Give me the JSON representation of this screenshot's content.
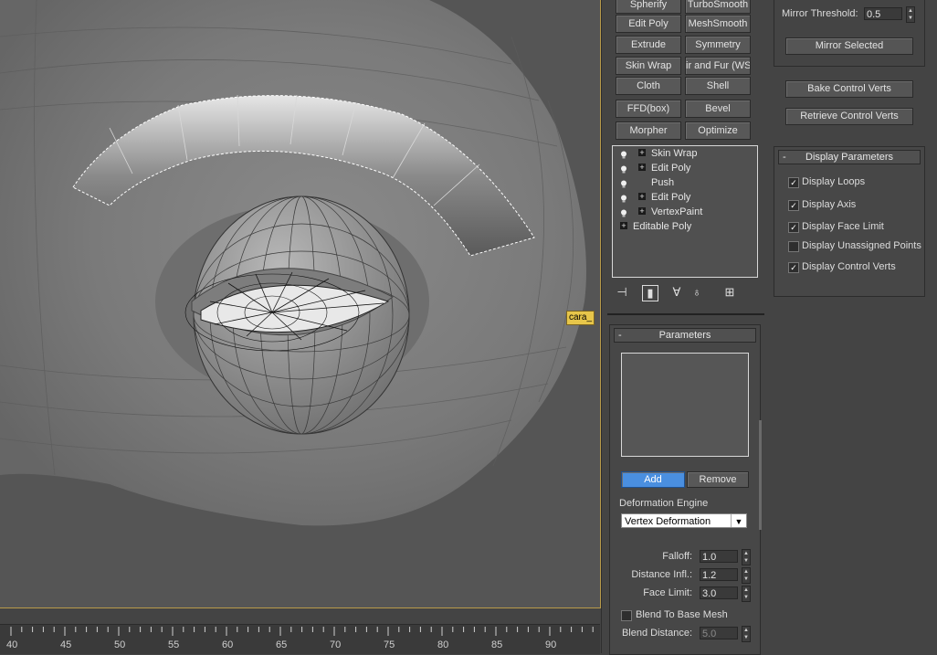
{
  "viewport": {
    "object_tag": "cara_"
  },
  "ruler": {
    "ticks": [
      "40",
      "45",
      "50",
      "55",
      "60",
      "65",
      "70",
      "75",
      "80",
      "85",
      "90"
    ]
  },
  "modifiers": {
    "buttons": [
      [
        "Spherify",
        "TurboSmooth"
      ],
      [
        "Edit Poly",
        "MeshSmooth"
      ],
      [
        "Extrude",
        "Symmetry"
      ],
      [
        "Skin Wrap",
        "ir and Fur (WS"
      ],
      [
        "Cloth",
        "Shell"
      ],
      [
        "FFD(box)",
        "Bevel"
      ],
      [
        "Morpher",
        "Optimize"
      ]
    ],
    "stack": [
      {
        "label": "Skin Wrap",
        "bulb": true,
        "plus": true
      },
      {
        "label": "Edit Poly",
        "bulb": true,
        "plus": true
      },
      {
        "label": "Push",
        "bulb": true,
        "plus": false
      },
      {
        "label": "Edit Poly",
        "bulb": true,
        "plus": true
      },
      {
        "label": "VertexPaint",
        "bulb": true,
        "plus": true
      },
      {
        "label": "Editable Poly",
        "bulb": false,
        "plus": true,
        "base": true
      }
    ],
    "stack_tools": [
      "pin-stack-icon",
      "show-end-result-icon",
      "make-unique-icon",
      "remove-modifier-icon",
      "configure-modifier-sets-icon"
    ]
  },
  "parameters": {
    "title": "Parameters",
    "collapse": "-",
    "add_label": "Add",
    "remove_label": "Remove",
    "deformation_engine_label": "Deformation Engine",
    "deformation_engine_value": "Vertex Deformation",
    "falloff_label": "Falloff:",
    "falloff_value": "1.0",
    "distance_infl_label": "Distance Infl.:",
    "distance_infl_value": "1.2",
    "face_limit_label": "Face Limit:",
    "face_limit_value": "3.0",
    "blend_label": "Blend To Base Mesh",
    "blend_checked": false,
    "blend_distance_label": "Blend Distance:",
    "blend_distance_value": "5.0"
  },
  "right": {
    "mirror_threshold_label": "Mirror Threshold:",
    "mirror_threshold_value": "0.5",
    "mirror_selected": "Mirror Selected",
    "bake_control_verts": "Bake Control Verts",
    "retrieve_control_verts": "Retrieve Control Verts",
    "display_title": "Display Parameters",
    "display_collapse": "-",
    "display_items": [
      {
        "label": "Display Loops",
        "checked": true
      },
      {
        "label": "Display Axis",
        "checked": true
      },
      {
        "label": "Display Face Limit",
        "checked": true
      },
      {
        "label": "Display Unassigned Points",
        "checked": false
      },
      {
        "label": "Display Control Verts",
        "checked": true
      }
    ]
  },
  "colors": {
    "accent_button": "#4a8fe0",
    "viewport_border": "#b89b4a",
    "tag_bg": "#e7c64a"
  }
}
